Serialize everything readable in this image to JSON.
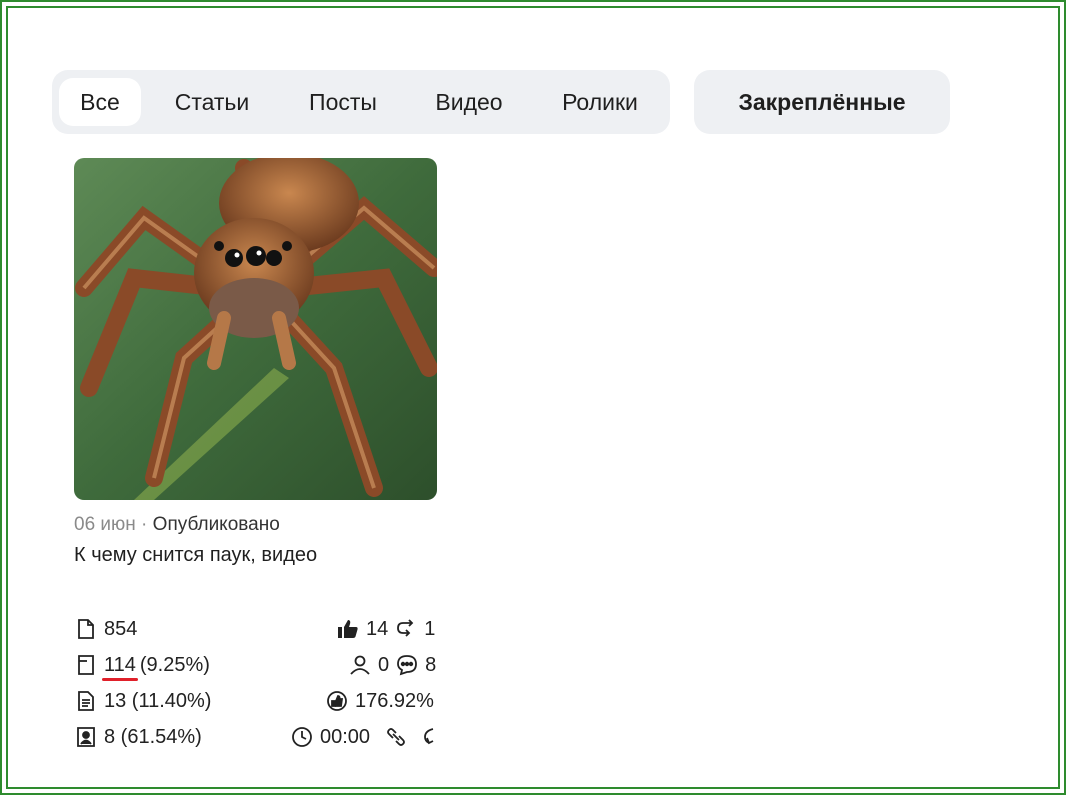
{
  "tabs": [
    {
      "label": "Все",
      "active": true
    },
    {
      "label": "Статьи",
      "active": false
    },
    {
      "label": "Посты",
      "active": false
    },
    {
      "label": "Видео",
      "active": false
    },
    {
      "label": "Ролики",
      "active": false
    }
  ],
  "pinned_label": "Закреплённые",
  "card": {
    "date": "06 июн",
    "separator": " · ",
    "status": "Опубликовано",
    "title": "К чему снится паук, видео",
    "thumbnail": "spider-photo"
  },
  "stats": {
    "impressions": "854",
    "views": "114",
    "views_pct": "(9.25%)",
    "reads": "13 (11.40%)",
    "finished": "8 (61.54%)",
    "likes": "14",
    "reposts": "1",
    "subscribers": "0",
    "comments": "8",
    "engagement": "176.92%",
    "time": "00:00"
  },
  "icons": {
    "impressions": "page-icon",
    "views": "page-folded-icon",
    "reads": "document-lines-icon",
    "finished": "image-doc-icon",
    "likes": "thumb-up-icon",
    "reposts": "repost-icon",
    "subscribers": "person-icon",
    "comments": "comment-icon",
    "engagement": "engagement-icon",
    "time": "clock-icon",
    "link": "link-icon",
    "share": "share-icon"
  },
  "colors": {
    "frame": "#2e8b2e",
    "tab_bg": "#eef0f3",
    "underline": "#e0202a",
    "muted": "#8a8a8a"
  }
}
